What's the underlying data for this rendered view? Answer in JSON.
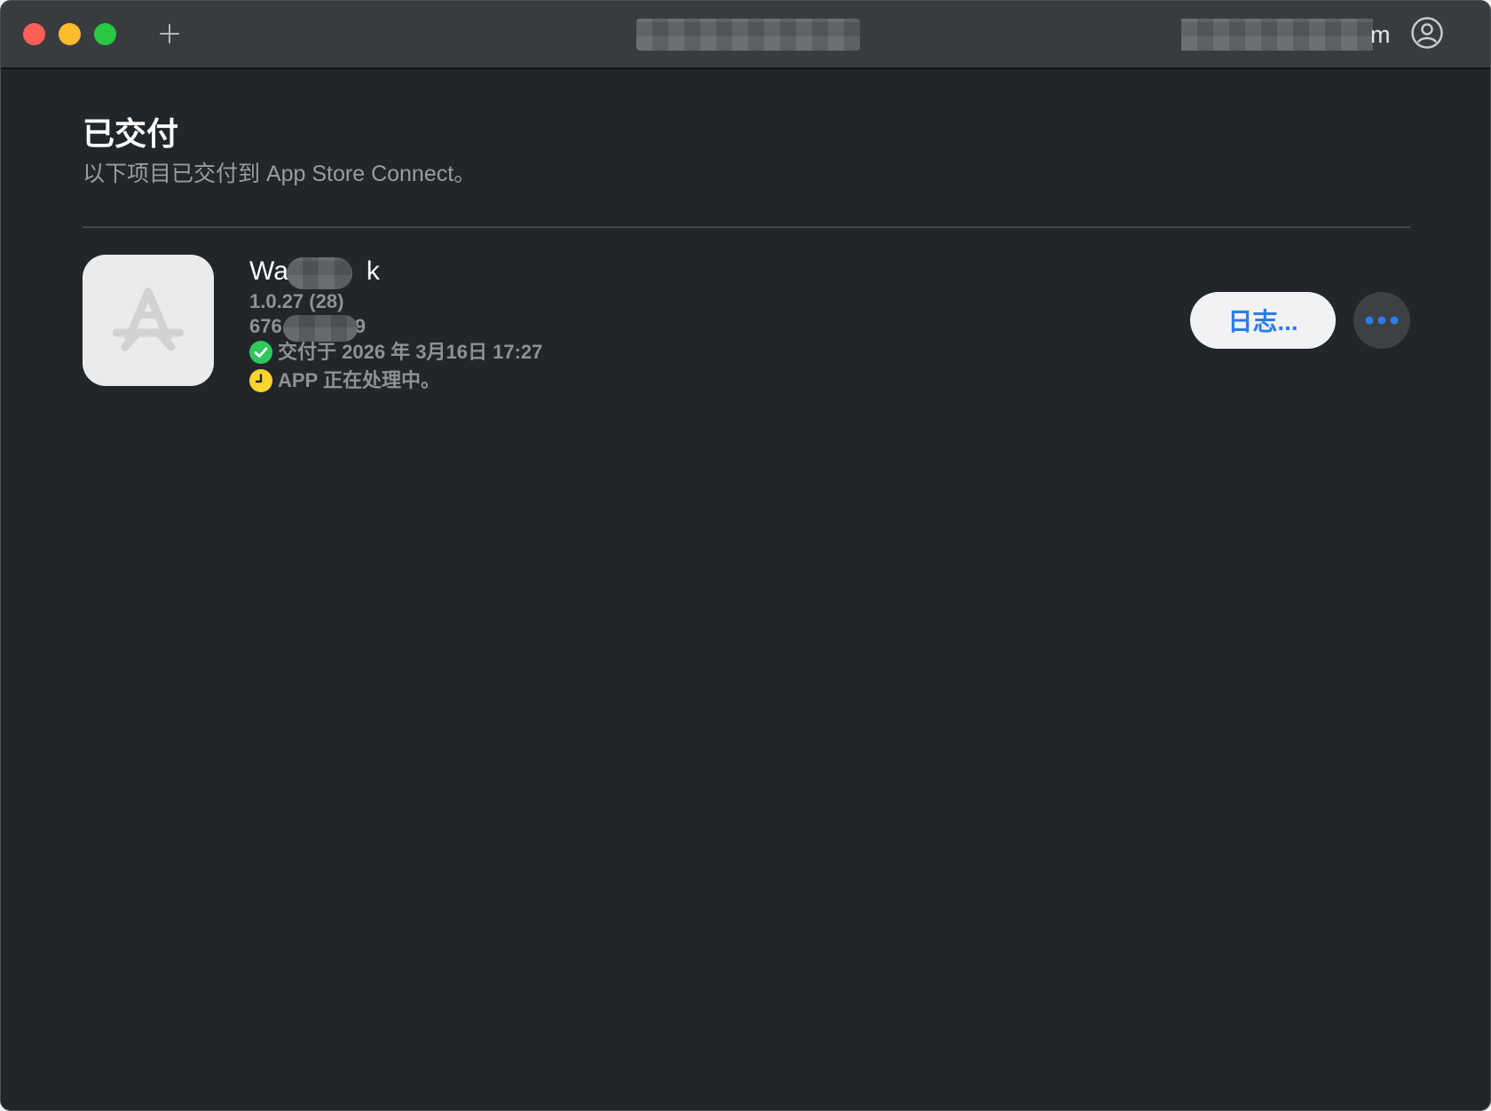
{
  "titlebar": {
    "add_icon": "plus-icon",
    "account_visible_suffix": "m",
    "account_icon": "person-circle-icon"
  },
  "main": {
    "section_title": "已交付",
    "section_subtitle": "以下项目已交付到 App Store Connect。"
  },
  "delivery": {
    "app_name_prefix": "Wa",
    "app_name_suffix": "k",
    "version": "1.0.27 (28)",
    "id_prefix": "676",
    "id_suffix": "9",
    "delivered_status": "交付于 2026 年 3月16日 17:27",
    "processing_status": "APP 正在处理中。",
    "log_button": "日志...",
    "more_icon": "ellipsis-icon",
    "colors": {
      "delivered": "#30c75a",
      "processing": "#fdd430",
      "accent": "#2a7de8"
    }
  }
}
